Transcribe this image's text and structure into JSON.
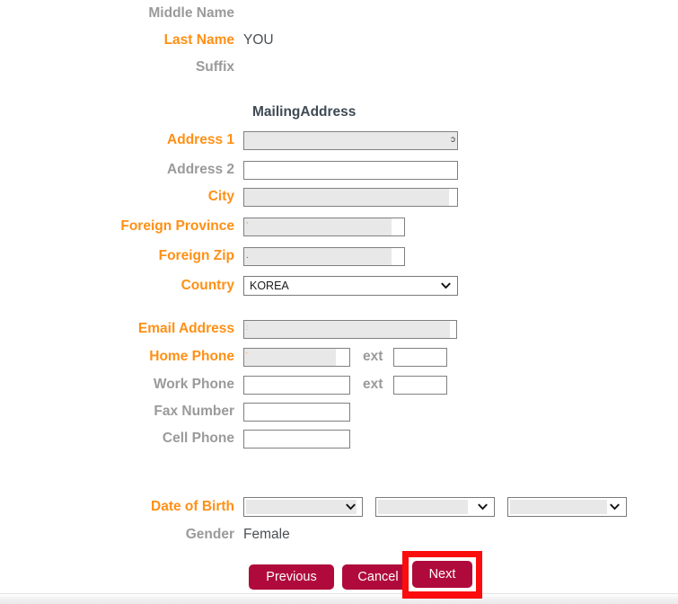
{
  "colors": {
    "required_label": "#ff9015",
    "optional_label": "#9a9a9a",
    "value_text": "#4b5055",
    "section_title": "#3f4a54",
    "button": "#b00a3c",
    "highlight": "#fb0d0d",
    "field_border": "#808080",
    "field_redaction": "#e8e8e8"
  },
  "personal": {
    "middle_name": {
      "label": "Middle Name",
      "required": false,
      "value": ""
    },
    "last_name": {
      "label": "Last Name",
      "required": true,
      "value": "YOU"
    },
    "suffix": {
      "label": "Suffix",
      "required": false,
      "value": ""
    }
  },
  "mailing_address": {
    "section_title": "MailingAddress",
    "fields": [
      {
        "label": "Address 1",
        "required": true,
        "value": "",
        "redacted": true,
        "ghost_right": "ɔ"
      },
      {
        "label": "Address 2",
        "required": false,
        "value": "",
        "redacted": false
      },
      {
        "label": "City",
        "required": true,
        "value": "",
        "redacted": true
      },
      {
        "label": "Foreign Province",
        "required": true,
        "value": "",
        "redacted": true,
        "ghost_left": "’"
      },
      {
        "label": "Foreign Zip",
        "required": true,
        "value": "",
        "redacted": true,
        "ghost_left": "."
      }
    ],
    "country": {
      "label": "Country",
      "required": true,
      "selected": "KOREA",
      "icon": "chevron-down-icon"
    }
  },
  "contact": {
    "email": {
      "label": "Email Address",
      "required": true,
      "value": "",
      "redacted": true
    },
    "home_phone": {
      "label": "Home Phone",
      "required": true,
      "value": "",
      "redacted": true,
      "ext_label": "ext",
      "ext_value": ""
    },
    "work_phone": {
      "label": "Work Phone",
      "required": false,
      "value": "",
      "redacted": false,
      "ext_label": "ext",
      "ext_value": ""
    },
    "fax": {
      "label": "Fax Number",
      "required": false,
      "value": "",
      "redacted": false
    },
    "cell_phone": {
      "label": "Cell Phone",
      "required": false,
      "value": "",
      "redacted": false
    }
  },
  "birth": {
    "label": "Date of Birth",
    "required": true,
    "month": {
      "selected": "",
      "icon": "chevron-down-icon"
    },
    "day": {
      "selected": "",
      "icon": "chevron-down-icon"
    },
    "year": {
      "selected": "",
      "icon": "chevron-down-icon"
    }
  },
  "gender": {
    "label": "Gender",
    "required": false,
    "value": "Female"
  },
  "actions": {
    "previous": "Previous",
    "cancel": "Cancel",
    "next": "Next"
  }
}
